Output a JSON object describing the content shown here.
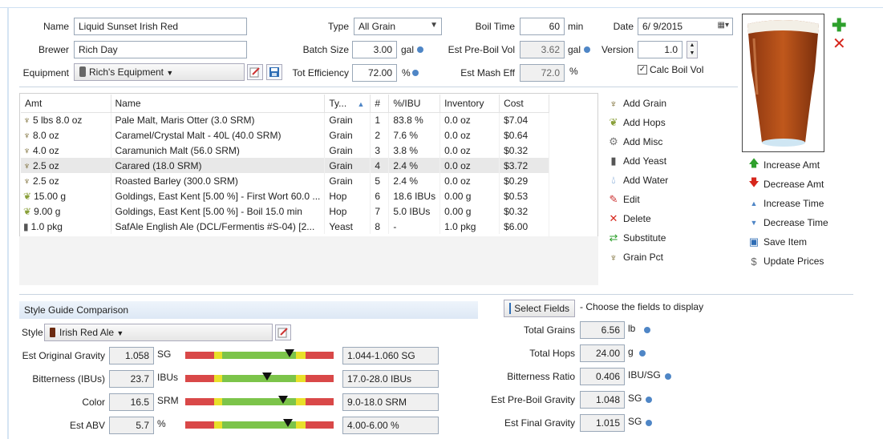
{
  "header": {
    "name_label": "Name",
    "name_value": "Liquid Sunset Irish Red",
    "brewer_label": "Brewer",
    "brewer_value": "Rich Day",
    "equipment_label": "Equipment",
    "equipment_value": "Rich's Equipment",
    "type_label": "Type",
    "type_value": "All Grain",
    "batch_label": "Batch Size",
    "batch_value": "3.00",
    "batch_unit": "gal",
    "eff_label": "Tot Efficiency",
    "eff_value": "72.00",
    "eff_unit": "%",
    "boil_time_label": "Boil Time",
    "boil_time_value": "60",
    "boil_time_unit": "min",
    "preboil_label": "Est Pre-Boil Vol",
    "preboil_value": "3.62",
    "preboil_unit": "gal",
    "mash_label": "Est Mash Eff",
    "mash_value": "72.0",
    "mash_unit": "%",
    "date_label": "Date",
    "date_value": "6/ 9/2015",
    "version_label": "Version",
    "version_value": "1.0",
    "calc_boil_label": "Calc Boil Vol",
    "calc_boil_checked": true
  },
  "ingredients": {
    "columns": [
      "Amt",
      "Name",
      "Ty...",
      "#",
      "%/IBU",
      "Inventory",
      "Cost"
    ],
    "rows": [
      {
        "icon": "grain",
        "amt": "5 lbs 8.0 oz",
        "name": "Pale Malt, Maris Otter (3.0 SRM)",
        "type": "Grain",
        "num": "1",
        "pct": "83.8 %",
        "inv": "0.0 oz",
        "cost": "$7.04"
      },
      {
        "icon": "grain",
        "amt": "8.0 oz",
        "name": "Caramel/Crystal Malt - 40L (40.0 SRM)",
        "type": "Grain",
        "num": "2",
        "pct": "7.6 %",
        "inv": "0.0 oz",
        "cost": "$0.64"
      },
      {
        "icon": "grain",
        "amt": "4.0 oz",
        "name": "Caramunich Malt (56.0 SRM)",
        "type": "Grain",
        "num": "3",
        "pct": "3.8 %",
        "inv": "0.0 oz",
        "cost": "$0.32"
      },
      {
        "icon": "grain",
        "amt": "2.5 oz",
        "name": "Carared (18.0 SRM)",
        "type": "Grain",
        "num": "4",
        "pct": "2.4 %",
        "inv": "0.0 oz",
        "cost": "$3.72"
      },
      {
        "icon": "grain",
        "amt": "2.5 oz",
        "name": "Roasted Barley (300.0 SRM)",
        "type": "Grain",
        "num": "5",
        "pct": "2.4 %",
        "inv": "0.0 oz",
        "cost": "$0.29"
      },
      {
        "icon": "hop",
        "amt": "15.00 g",
        "name": "Goldings, East Kent [5.00 %] - First Wort 60.0 ...",
        "type": "Hop",
        "num": "6",
        "pct": "18.6 IBUs",
        "inv": "0.00 g",
        "cost": "$0.53"
      },
      {
        "icon": "hop",
        "amt": "9.00 g",
        "name": "Goldings, East Kent [5.00 %] - Boil 15.0 min",
        "type": "Hop",
        "num": "7",
        "pct": "5.0 IBUs",
        "inv": "0.00 g",
        "cost": "$0.32"
      },
      {
        "icon": "yeast",
        "amt": "1.0 pkg",
        "name": "SafAle English Ale (DCL/Fermentis #S-04) [2...",
        "type": "Yeast",
        "num": "8",
        "pct": "-",
        "inv": "1.0 pkg",
        "cost": "$6.00"
      }
    ]
  },
  "actions": {
    "add_grain": "Add Grain",
    "add_hops": "Add Hops",
    "add_misc": "Add Misc",
    "add_yeast": "Add Yeast",
    "add_water": "Add Water",
    "edit": "Edit",
    "delete": "Delete",
    "substitute": "Substitute",
    "grain_pct": "Grain Pct",
    "increase_amt": "Increase Amt",
    "decrease_amt": "Decrease Amt",
    "increase_time": "Increase Time",
    "decrease_time": "Decrease Time",
    "save_item": "Save Item",
    "update_prices": "Update Prices"
  },
  "style": {
    "header": "Style Guide Comparison",
    "style_label": "Style",
    "style_value": "Irish Red Ale",
    "rows": [
      {
        "label": "Est Original Gravity",
        "value": "1.058",
        "unit": "SG",
        "range": "1.044-1.060 SG",
        "marker": 0.7
      },
      {
        "label": "Bitterness (IBUs)",
        "value": "23.7",
        "unit": "IBUs",
        "range": "17.0-28.0 IBUs",
        "marker": 0.55
      },
      {
        "label": "Color",
        "value": "16.5",
        "unit": "SRM",
        "range": "9.0-18.0 SRM",
        "marker": 0.66
      },
      {
        "label": "Est ABV",
        "value": "5.7",
        "unit": "%",
        "range": "4.00-6.00 %",
        "marker": 0.69
      }
    ]
  },
  "fields": {
    "select_label": "Select Fields",
    "hint": "- Choose the fields to display",
    "rows": [
      {
        "label": "Total Grains",
        "value": "6.56",
        "unit": "lb"
      },
      {
        "label": "Total Hops",
        "value": "24.00",
        "unit": "g"
      },
      {
        "label": "Bitterness Ratio",
        "value": "0.406",
        "unit": "IBU/SG"
      },
      {
        "label": "Est Pre-Boil Gravity",
        "value": "1.048",
        "unit": "SG"
      },
      {
        "label": "Est Final Gravity",
        "value": "1.015",
        "unit": "SG"
      }
    ]
  },
  "colors": {
    "accent": "#4f86c6",
    "beer": "#b5501c",
    "green": "#33a02c",
    "red": "#d6261c"
  }
}
